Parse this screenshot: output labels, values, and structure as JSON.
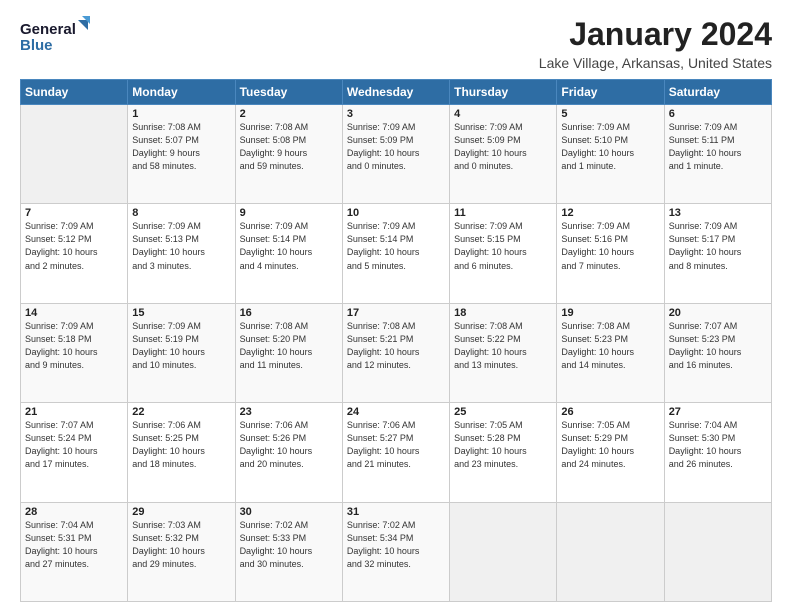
{
  "logo": {
    "line1": "General",
    "line2": "Blue"
  },
  "title": "January 2024",
  "subtitle": "Lake Village, Arkansas, United States",
  "days_of_week": [
    "Sunday",
    "Monday",
    "Tuesday",
    "Wednesday",
    "Thursday",
    "Friday",
    "Saturday"
  ],
  "weeks": [
    [
      {
        "num": "",
        "info": ""
      },
      {
        "num": "1",
        "info": "Sunrise: 7:08 AM\nSunset: 5:07 PM\nDaylight: 9 hours\nand 58 minutes."
      },
      {
        "num": "2",
        "info": "Sunrise: 7:08 AM\nSunset: 5:08 PM\nDaylight: 9 hours\nand 59 minutes."
      },
      {
        "num": "3",
        "info": "Sunrise: 7:09 AM\nSunset: 5:09 PM\nDaylight: 10 hours\nand 0 minutes."
      },
      {
        "num": "4",
        "info": "Sunrise: 7:09 AM\nSunset: 5:09 PM\nDaylight: 10 hours\nand 0 minutes."
      },
      {
        "num": "5",
        "info": "Sunrise: 7:09 AM\nSunset: 5:10 PM\nDaylight: 10 hours\nand 1 minute."
      },
      {
        "num": "6",
        "info": "Sunrise: 7:09 AM\nSunset: 5:11 PM\nDaylight: 10 hours\nand 1 minute."
      }
    ],
    [
      {
        "num": "7",
        "info": "Sunrise: 7:09 AM\nSunset: 5:12 PM\nDaylight: 10 hours\nand 2 minutes."
      },
      {
        "num": "8",
        "info": "Sunrise: 7:09 AM\nSunset: 5:13 PM\nDaylight: 10 hours\nand 3 minutes."
      },
      {
        "num": "9",
        "info": "Sunrise: 7:09 AM\nSunset: 5:14 PM\nDaylight: 10 hours\nand 4 minutes."
      },
      {
        "num": "10",
        "info": "Sunrise: 7:09 AM\nSunset: 5:14 PM\nDaylight: 10 hours\nand 5 minutes."
      },
      {
        "num": "11",
        "info": "Sunrise: 7:09 AM\nSunset: 5:15 PM\nDaylight: 10 hours\nand 6 minutes."
      },
      {
        "num": "12",
        "info": "Sunrise: 7:09 AM\nSunset: 5:16 PM\nDaylight: 10 hours\nand 7 minutes."
      },
      {
        "num": "13",
        "info": "Sunrise: 7:09 AM\nSunset: 5:17 PM\nDaylight: 10 hours\nand 8 minutes."
      }
    ],
    [
      {
        "num": "14",
        "info": "Sunrise: 7:09 AM\nSunset: 5:18 PM\nDaylight: 10 hours\nand 9 minutes."
      },
      {
        "num": "15",
        "info": "Sunrise: 7:09 AM\nSunset: 5:19 PM\nDaylight: 10 hours\nand 10 minutes."
      },
      {
        "num": "16",
        "info": "Sunrise: 7:08 AM\nSunset: 5:20 PM\nDaylight: 10 hours\nand 11 minutes."
      },
      {
        "num": "17",
        "info": "Sunrise: 7:08 AM\nSunset: 5:21 PM\nDaylight: 10 hours\nand 12 minutes."
      },
      {
        "num": "18",
        "info": "Sunrise: 7:08 AM\nSunset: 5:22 PM\nDaylight: 10 hours\nand 13 minutes."
      },
      {
        "num": "19",
        "info": "Sunrise: 7:08 AM\nSunset: 5:23 PM\nDaylight: 10 hours\nand 14 minutes."
      },
      {
        "num": "20",
        "info": "Sunrise: 7:07 AM\nSunset: 5:23 PM\nDaylight: 10 hours\nand 16 minutes."
      }
    ],
    [
      {
        "num": "21",
        "info": "Sunrise: 7:07 AM\nSunset: 5:24 PM\nDaylight: 10 hours\nand 17 minutes."
      },
      {
        "num": "22",
        "info": "Sunrise: 7:06 AM\nSunset: 5:25 PM\nDaylight: 10 hours\nand 18 minutes."
      },
      {
        "num": "23",
        "info": "Sunrise: 7:06 AM\nSunset: 5:26 PM\nDaylight: 10 hours\nand 20 minutes."
      },
      {
        "num": "24",
        "info": "Sunrise: 7:06 AM\nSunset: 5:27 PM\nDaylight: 10 hours\nand 21 minutes."
      },
      {
        "num": "25",
        "info": "Sunrise: 7:05 AM\nSunset: 5:28 PM\nDaylight: 10 hours\nand 23 minutes."
      },
      {
        "num": "26",
        "info": "Sunrise: 7:05 AM\nSunset: 5:29 PM\nDaylight: 10 hours\nand 24 minutes."
      },
      {
        "num": "27",
        "info": "Sunrise: 7:04 AM\nSunset: 5:30 PM\nDaylight: 10 hours\nand 26 minutes."
      }
    ],
    [
      {
        "num": "28",
        "info": "Sunrise: 7:04 AM\nSunset: 5:31 PM\nDaylight: 10 hours\nand 27 minutes."
      },
      {
        "num": "29",
        "info": "Sunrise: 7:03 AM\nSunset: 5:32 PM\nDaylight: 10 hours\nand 29 minutes."
      },
      {
        "num": "30",
        "info": "Sunrise: 7:02 AM\nSunset: 5:33 PM\nDaylight: 10 hours\nand 30 minutes."
      },
      {
        "num": "31",
        "info": "Sunrise: 7:02 AM\nSunset: 5:34 PM\nDaylight: 10 hours\nand 32 minutes."
      },
      {
        "num": "",
        "info": ""
      },
      {
        "num": "",
        "info": ""
      },
      {
        "num": "",
        "info": ""
      }
    ]
  ]
}
